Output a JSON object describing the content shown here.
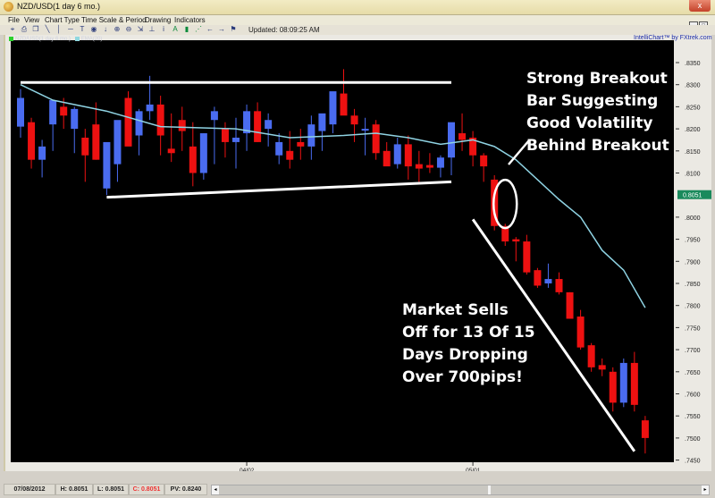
{
  "window": {
    "title": "NZD/USD(1 day  6 mo.)",
    "close_label": "x"
  },
  "menu": [
    "File",
    "View",
    "Chart Type",
    "Time Scale & Period",
    "Drawing",
    "Indicators"
  ],
  "toolbar": {
    "icons": [
      "crosshair-icon",
      "print-icon",
      "copy-icon",
      "trendline-icon",
      "vertical-line-icon",
      "horizontal-line-icon",
      "text-icon",
      "circle-icon",
      "arrow-down-icon",
      "zoom-in-icon",
      "zoom-out-icon",
      "fit-icon",
      "baseline-icon",
      "info-icon",
      "font-icon",
      "bar-chart-icon",
      "line-chart-icon",
      "scroll-left-icon",
      "scroll-right-icon",
      "flag-icon"
    ],
    "glyphs": [
      "⌖",
      "⎙",
      "❐",
      "╲",
      "│",
      "─",
      "T",
      "◉",
      "↓",
      "⊕",
      "⊖",
      "⇲",
      "⊥",
      "i",
      "A",
      "▮",
      "⋰",
      "←",
      "→",
      "⚑"
    ],
    "updated": "Updated: 08:09:25 AM"
  },
  "brand": "IntelliChart™ by FXtrek.com",
  "legend": [
    {
      "label": "NZD/USD(1 day  6 mo.)",
      "color": "#2bd12b"
    },
    {
      "label": "EMA(20)",
      "color": "#8fd8e0"
    }
  ],
  "colors": {
    "up": "#4a6cf0",
    "down": "#ee1111",
    "ema": "#8fd3e3",
    "price_tag": "#1a8a5c"
  },
  "statusbar": {
    "date": "07/08/2012",
    "high": "H: 0.8051",
    "low": "L: 0.8051",
    "close": "C: 0.8051",
    "pv": "PV: 0.8240"
  },
  "chart_data": {
    "type": "candlestick",
    "title": "NZD/USD(1 day 6 mo.)",
    "ylim": [
      0.745,
      0.838
    ],
    "y_ticks": [
      ".8350",
      ".8300",
      ".8250",
      ".8200",
      ".8150",
      ".8100",
      ".8000",
      ".7950",
      ".7900",
      ".7850",
      ".7800",
      ".7750",
      ".7700",
      ".7650",
      ".7600",
      ".7550",
      ".7500",
      ".7450"
    ],
    "y_tick_values": [
      0.835,
      0.83,
      0.825,
      0.82,
      0.815,
      0.81,
      0.8,
      0.795,
      0.79,
      0.785,
      0.78,
      0.775,
      0.77,
      0.765,
      0.76,
      0.755,
      0.75,
      0.745
    ],
    "current_price_label": "0.8051",
    "current_price": 0.8051,
    "x_ticks": [
      {
        "label": "04/02",
        "index": 21
      },
      {
        "label": "05/01",
        "index": 42
      }
    ],
    "candles": [
      {
        "o": 0.8205,
        "h": 0.829,
        "l": 0.818,
        "c": 0.827
      },
      {
        "o": 0.8215,
        "h": 0.8225,
        "l": 0.811,
        "c": 0.813
      },
      {
        "o": 0.813,
        "h": 0.8175,
        "l": 0.809,
        "c": 0.816
      },
      {
        "o": 0.821,
        "h": 0.824,
        "l": 0.815,
        "c": 0.8265
      },
      {
        "o": 0.825,
        "h": 0.827,
        "l": 0.82,
        "c": 0.823
      },
      {
        "o": 0.82,
        "h": 0.825,
        "l": 0.8145,
        "c": 0.8245
      },
      {
        "o": 0.818,
        "h": 0.82,
        "l": 0.808,
        "c": 0.814
      },
      {
        "o": 0.821,
        "h": 0.826,
        "l": 0.813,
        "c": 0.813
      },
      {
        "o": 0.8065,
        "h": 0.814,
        "l": 0.805,
        "c": 0.817
      },
      {
        "o": 0.812,
        "h": 0.813,
        "l": 0.808,
        "c": 0.822
      },
      {
        "o": 0.827,
        "h": 0.8285,
        "l": 0.817,
        "c": 0.816
      },
      {
        "o": 0.8185,
        "h": 0.8245,
        "l": 0.814,
        "c": 0.824
      },
      {
        "o": 0.824,
        "h": 0.832,
        "l": 0.822,
        "c": 0.8255
      },
      {
        "o": 0.8255,
        "h": 0.8275,
        "l": 0.814,
        "c": 0.8185
      },
      {
        "o": 0.8155,
        "h": 0.8235,
        "l": 0.8125,
        "c": 0.8145
      },
      {
        "o": 0.822,
        "h": 0.825,
        "l": 0.815,
        "c": 0.8195
      },
      {
        "o": 0.816,
        "h": 0.8215,
        "l": 0.807,
        "c": 0.81
      },
      {
        "o": 0.81,
        "h": 0.819,
        "l": 0.8085,
        "c": 0.819
      },
      {
        "o": 0.822,
        "h": 0.825,
        "l": 0.812,
        "c": 0.824
      },
      {
        "o": 0.82,
        "h": 0.8215,
        "l": 0.8135,
        "c": 0.817
      },
      {
        "o": 0.817,
        "h": 0.8225,
        "l": 0.811,
        "c": 0.818
      },
      {
        "o": 0.819,
        "h": 0.8255,
        "l": 0.815,
        "c": 0.824
      },
      {
        "o": 0.824,
        "h": 0.826,
        "l": 0.817,
        "c": 0.817
      },
      {
        "o": 0.82,
        "h": 0.8235,
        "l": 0.816,
        "c": 0.822
      },
      {
        "o": 0.814,
        "h": 0.819,
        "l": 0.812,
        "c": 0.817
      },
      {
        "o": 0.815,
        "h": 0.8195,
        "l": 0.811,
        "c": 0.813
      },
      {
        "o": 0.817,
        "h": 0.82,
        "l": 0.813,
        "c": 0.816
      },
      {
        "o": 0.816,
        "h": 0.823,
        "l": 0.813,
        "c": 0.821
      },
      {
        "o": 0.8195,
        "h": 0.8225,
        "l": 0.815,
        "c": 0.8235
      },
      {
        "o": 0.821,
        "h": 0.827,
        "l": 0.819,
        "c": 0.8285
      },
      {
        "o": 0.828,
        "h": 0.8335,
        "l": 0.825,
        "c": 0.823
      },
      {
        "o": 0.823,
        "h": 0.8245,
        "l": 0.817,
        "c": 0.821
      },
      {
        "o": 0.82,
        "h": 0.8225,
        "l": 0.814,
        "c": 0.82
      },
      {
        "o": 0.821,
        "h": 0.822,
        "l": 0.813,
        "c": 0.8145
      },
      {
        "o": 0.815,
        "h": 0.817,
        "l": 0.812,
        "c": 0.8115
      },
      {
        "o": 0.812,
        "h": 0.818,
        "l": 0.811,
        "c": 0.8165
      },
      {
        "o": 0.8165,
        "h": 0.8185,
        "l": 0.8085,
        "c": 0.8115
      },
      {
        "o": 0.812,
        "h": 0.815,
        "l": 0.808,
        "c": 0.811
      },
      {
        "o": 0.8118,
        "h": 0.8145,
        "l": 0.81,
        "c": 0.8112
      },
      {
        "o": 0.8112,
        "h": 0.814,
        "l": 0.809,
        "c": 0.8135
      },
      {
        "o": 0.8135,
        "h": 0.8185,
        "l": 0.8095,
        "c": 0.8215
      },
      {
        "o": 0.819,
        "h": 0.8235,
        "l": 0.815,
        "c": 0.8175
      },
      {
        "o": 0.818,
        "h": 0.8195,
        "l": 0.8115,
        "c": 0.814
      },
      {
        "o": 0.814,
        "h": 0.8145,
        "l": 0.808,
        "c": 0.8115
      },
      {
        "o": 0.8085,
        "h": 0.8095,
        "l": 0.797,
        "c": 0.798
      },
      {
        "o": 0.798,
        "h": 0.7985,
        "l": 0.7935,
        "c": 0.7945
      },
      {
        "o": 0.795,
        "h": 0.7955,
        "l": 0.79,
        "c": 0.7945
      },
      {
        "o": 0.7945,
        "h": 0.796,
        "l": 0.787,
        "c": 0.7875
      },
      {
        "o": 0.788,
        "h": 0.7885,
        "l": 0.784,
        "c": 0.7845
      },
      {
        "o": 0.785,
        "h": 0.7895,
        "l": 0.784,
        "c": 0.786
      },
      {
        "o": 0.786,
        "h": 0.7875,
        "l": 0.7825,
        "c": 0.783
      },
      {
        "o": 0.783,
        "h": 0.783,
        "l": 0.777,
        "c": 0.777
      },
      {
        "o": 0.7775,
        "h": 0.779,
        "l": 0.77,
        "c": 0.7705
      },
      {
        "o": 0.771,
        "h": 0.7715,
        "l": 0.765,
        "c": 0.766
      },
      {
        "o": 0.7665,
        "h": 0.768,
        "l": 0.764,
        "c": 0.7655
      },
      {
        "o": 0.765,
        "h": 0.766,
        "l": 0.756,
        "c": 0.758
      },
      {
        "o": 0.758,
        "h": 0.768,
        "l": 0.757,
        "c": 0.767
      },
      {
        "o": 0.767,
        "h": 0.7695,
        "l": 0.756,
        "c": 0.7575
      },
      {
        "o": 0.754,
        "h": 0.755,
        "l": 0.7465,
        "c": 0.75
      }
    ],
    "ema20": [
      [
        0,
        0.83
      ],
      [
        3,
        0.8265
      ],
      [
        8,
        0.824
      ],
      [
        13,
        0.8205
      ],
      [
        20,
        0.82
      ],
      [
        25,
        0.818
      ],
      [
        30,
        0.8185
      ],
      [
        33,
        0.819
      ],
      [
        36,
        0.818
      ],
      [
        39,
        0.8165
      ],
      [
        42,
        0.8175
      ],
      [
        44,
        0.816
      ],
      [
        46,
        0.813
      ],
      [
        48,
        0.8085
      ],
      [
        50,
        0.804
      ],
      [
        52,
        0.8
      ],
      [
        54,
        0.7925
      ],
      [
        56,
        0.788
      ],
      [
        58,
        0.7795
      ]
    ],
    "annotations": [
      {
        "type": "hline",
        "label": "resistance",
        "from": [
          0,
          0.8305
        ],
        "to": [
          40,
          0.8305
        ]
      },
      {
        "type": "line",
        "label": "support",
        "from": [
          8,
          0.8045
        ],
        "to": [
          40,
          0.808
        ]
      },
      {
        "type": "line",
        "label": "downtrend",
        "from": [
          42,
          0.7995
        ],
        "to": [
          57,
          0.747
        ]
      },
      {
        "type": "ellipse",
        "label": "breakout-bar",
        "at": [
          45,
          0.803
        ]
      },
      {
        "type": "pointer",
        "label": "annotation-arrow"
      }
    ],
    "text_annotations": {
      "breakout": [
        "Strong Breakout",
        "Bar Suggesting",
        "Good Volatility",
        "Behind Breakout"
      ],
      "selloff": [
        "Market Sells",
        "Off for 13 Of 15",
        "Days Dropping",
        "Over 700pips!"
      ]
    }
  }
}
